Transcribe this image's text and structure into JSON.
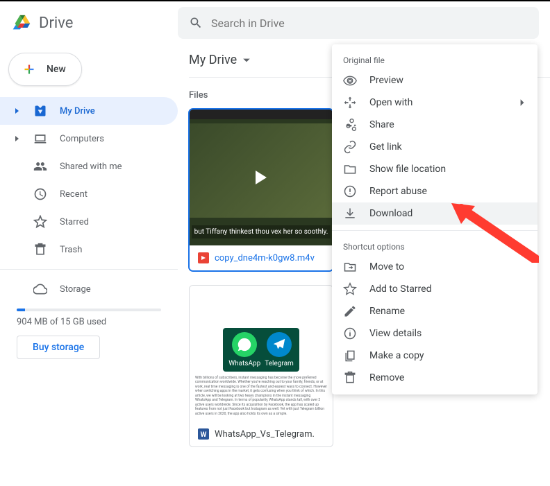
{
  "header": {
    "app_name": "Drive",
    "search_placeholder": "Search in Drive"
  },
  "sidebar": {
    "new_label": "New",
    "items": [
      {
        "label": "My Drive",
        "expandable": true,
        "active": true
      },
      {
        "label": "Computers",
        "expandable": true,
        "active": false
      },
      {
        "label": "Shared with me",
        "expandable": false,
        "active": false
      },
      {
        "label": "Recent",
        "expandable": false,
        "active": false
      },
      {
        "label": "Starred",
        "expandable": false,
        "active": false
      },
      {
        "label": "Trash",
        "expandable": false,
        "active": false
      }
    ],
    "storage_label": "Storage",
    "storage_text": "904 MB of 15 GB used",
    "buy_label": "Buy storage"
  },
  "content": {
    "breadcrumb": "My Drive",
    "section_label": "Files",
    "files": [
      {
        "name": "copy_dne4m-k0gw8.m4v",
        "subtitle": "but Tiffany thinkest thou vex her so soothly."
      },
      {
        "name": "WhatsApp_Vs_Telegram."
      }
    ],
    "doc_badges": {
      "wa": "WhatsApp",
      "tg": "Telegram"
    }
  },
  "context_menu": {
    "section1_label": "Original file",
    "section2_label": "Shortcut options",
    "items1": [
      {
        "label": "Preview"
      },
      {
        "label": "Open with",
        "submenu": true
      },
      {
        "label": "Share"
      },
      {
        "label": "Get link"
      },
      {
        "label": "Show file location"
      },
      {
        "label": "Report abuse"
      },
      {
        "label": "Download",
        "highlighted": true
      }
    ],
    "items2": [
      {
        "label": "Move to"
      },
      {
        "label": "Add to Starred"
      },
      {
        "label": "Rename"
      },
      {
        "label": "View details"
      },
      {
        "label": "Make a copy"
      },
      {
        "label": "Remove"
      }
    ]
  }
}
